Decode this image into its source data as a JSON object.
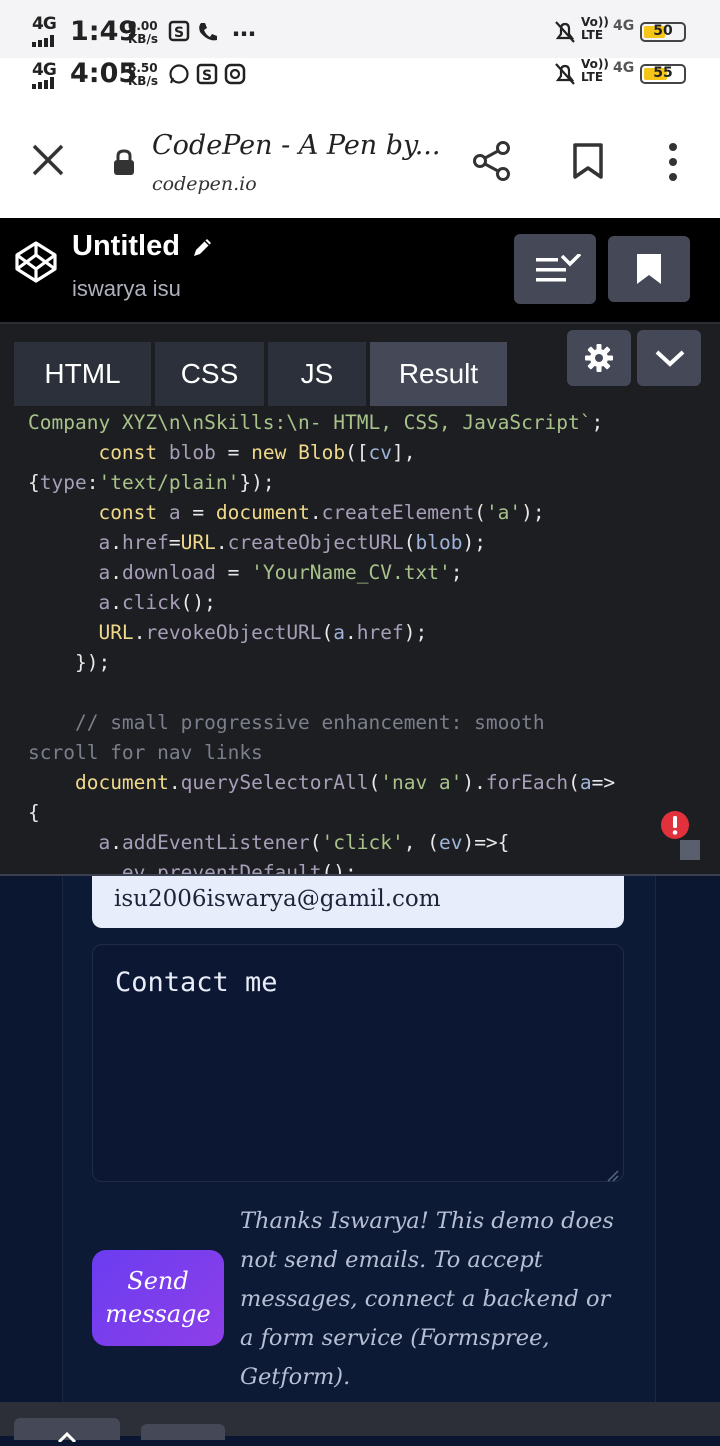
{
  "status_bar_1": {
    "network": "4G",
    "time": "1:49",
    "speed_value": "0.00",
    "speed_unit": "KB/s",
    "more": "…",
    "volte": "Vo)) LTE",
    "net_type": "4G",
    "battery": "50"
  },
  "status_bar_2": {
    "network": "4G",
    "time": "4:05",
    "speed_value": "6.50",
    "speed_unit": "KB/s",
    "volte": "Vo)) LTE",
    "net_type": "4G",
    "battery": "55"
  },
  "browser": {
    "page_title": "CodePen - A Pen by...",
    "url": "codepen.io"
  },
  "codepen": {
    "pen_title": "Untitled",
    "author": "iswarya isu"
  },
  "editor": {
    "tabs": [
      "HTML",
      "CSS",
      "JS",
      "Result"
    ]
  },
  "result": {
    "email_value": "isu2006iswarya@gamil.com",
    "message_value": "Contact me",
    "send_label_line1": "Send",
    "send_label_line2": "message",
    "note": "Thanks Iswarya! This demo does not send emails. To accept messages, connect a backend or a form service (Formspree, Getform)."
  },
  "colors": {
    "codepen_bg": "#000000",
    "editor_bg": "#1d1e22",
    "result_bg": "#0b1630",
    "send_button": "#7b3ff0",
    "error_badge": "#e0313c"
  }
}
